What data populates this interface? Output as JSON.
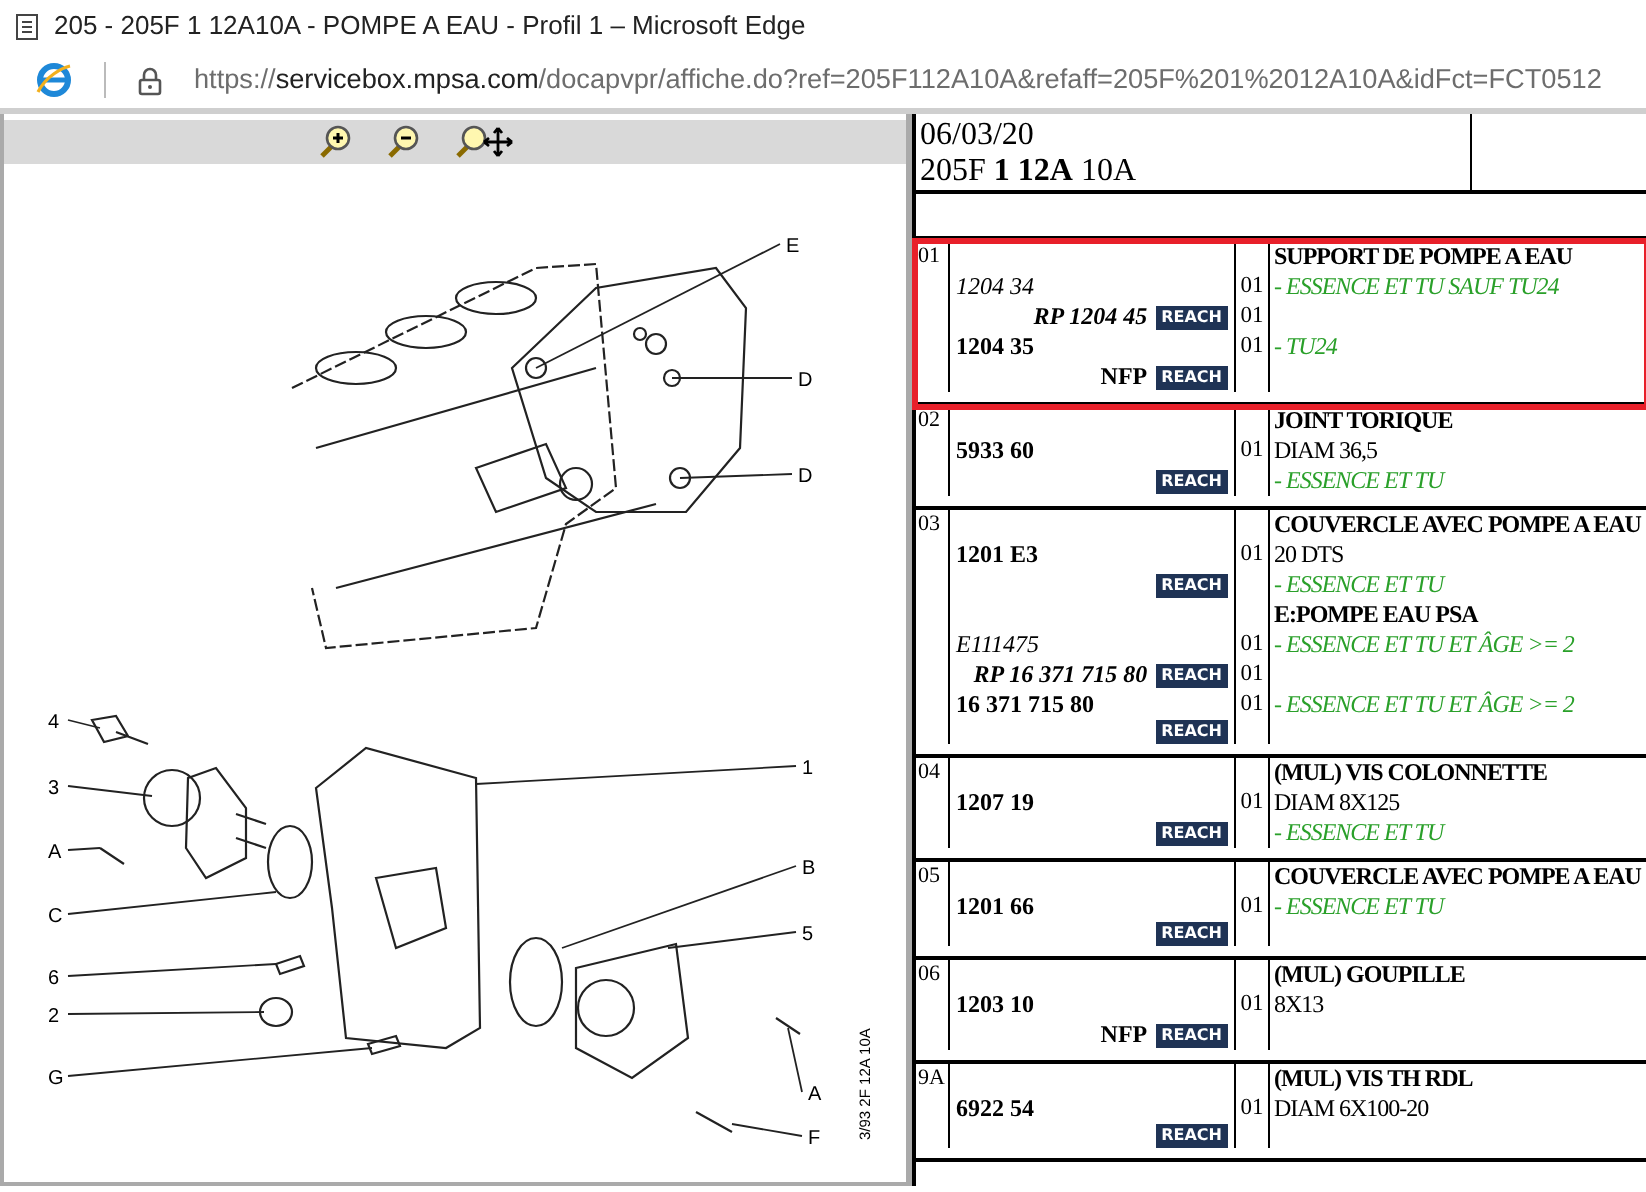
{
  "window": {
    "title": "205 - 205F 1 12A10A - POMPE A EAU - Profil 1 – Microsoft Edge"
  },
  "address_bar": {
    "scheme": "https://",
    "host": "servicebox.mpsa.com",
    "path": "/docapvpr/affiche.do?ref=205F112A10A&refaff=205F%201%2012A10A&idFct=FCT0512"
  },
  "diagram": {
    "callouts": [
      "E",
      "D",
      "D",
      "4",
      "3",
      "A",
      "C",
      "6",
      "2",
      "G",
      "1",
      "B",
      "5",
      "A",
      "F"
    ],
    "stamp": "3/93 2F 12A 10A"
  },
  "header": {
    "date": "06/03/20",
    "model": "205F **1 12A** 10A"
  },
  "rows": [
    {
      "ref": "01",
      "highlighted": true,
      "lines": [
        {
          "desc": "SUPPORT DE POMPE A EAU",
          "desc_bold": true
        },
        {
          "part": "1204 34",
          "part_italic": true,
          "qty": "01",
          "desc": "- ESSENCE ET TU SAUF TU24",
          "desc_italic": true,
          "color": "#2aa02a"
        },
        {
          "part": "RP 1204 45",
          "part_bold": true,
          "part_italic": true,
          "reach": "REACH",
          "qty": "01"
        },
        {
          "part": "1204 35",
          "part_bold": true,
          "qty": "01",
          "desc": "- TU24",
          "desc_italic": true,
          "color": "#2aa02a"
        },
        {
          "part": "NFP",
          "part_bold": true,
          "reach": "REACH"
        }
      ]
    },
    {
      "ref": "02",
      "highlighted": false,
      "lines": [
        {
          "desc": "JOINT TORIQUE",
          "desc_bold": true
        },
        {
          "part": "5933 60",
          "part_bold": true,
          "qty": "01",
          "desc": "DIAM 36,5"
        },
        {
          "reach": "REACH",
          "desc": "- ESSENCE ET TU",
          "desc_italic": true,
          "color": "#2aa02a"
        }
      ]
    },
    {
      "ref": "03",
      "highlighted": false,
      "lines": [
        {
          "desc": "COUVERCLE AVEC POMPE A EAU",
          "desc_bold": true
        },
        {
          "part": "1201 E3",
          "part_bold": true,
          "qty": "01",
          "desc": "20 DTS"
        },
        {
          "reach": "REACH",
          "desc": "- ESSENCE ET TU",
          "desc_italic": true,
          "color": "#2aa02a"
        },
        {
          "desc": "E:POMPE EAU PSA",
          "desc_bold": true
        },
        {
          "part": "E111475",
          "part_italic": true,
          "qty": "01",
          "desc": "- ESSENCE ET TU ET ÂGE >= 2",
          "desc_italic": true,
          "color": "#2aa02a"
        },
        {
          "part": "RP 16 371 715 80",
          "part_bold": true,
          "part_italic": true,
          "reach": "REACH",
          "qty": "01"
        },
        {
          "part": "16 371 715 80",
          "part_bold": true,
          "qty": "01",
          "desc": "- ESSENCE ET TU ET ÂGE >= 2",
          "desc_italic": true,
          "color": "#2aa02a"
        },
        {
          "reach": "REACH"
        }
      ]
    },
    {
      "ref": "04",
      "highlighted": false,
      "lines": [
        {
          "desc": "(MUL) VIS COLONNETTE",
          "desc_bold": true
        },
        {
          "part": "1207 19",
          "part_bold": true,
          "qty": "01",
          "desc": "DIAM 8X125"
        },
        {
          "reach": "REACH",
          "desc": "- ESSENCE ET TU",
          "desc_italic": true,
          "color": "#2aa02a"
        }
      ]
    },
    {
      "ref": "05",
      "highlighted": false,
      "lines": [
        {
          "desc": "COUVERCLE AVEC POMPE A EAU",
          "desc_bold": true
        },
        {
          "part": "1201 66",
          "part_bold": true,
          "qty": "01",
          "desc": "- ESSENCE ET TU",
          "desc_italic": true,
          "color": "#2aa02a"
        },
        {
          "reach": "REACH"
        }
      ]
    },
    {
      "ref": "06",
      "highlighted": false,
      "lines": [
        {
          "desc": "(MUL) GOUPILLE",
          "desc_bold": true
        },
        {
          "part": "1203 10",
          "part_bold": true,
          "qty": "01",
          "desc": "8X13"
        },
        {
          "part": "NFP",
          "part_bold": true,
          "reach": "REACH"
        }
      ]
    },
    {
      "ref": "9A",
      "highlighted": false,
      "lines": [
        {
          "desc": "(MUL) VIS TH RDL",
          "desc_bold": true
        },
        {
          "part": "6922 54",
          "part_bold": true,
          "qty": "01",
          "desc": "DIAM 6X100-20"
        },
        {
          "reach": "REACH"
        }
      ]
    }
  ]
}
